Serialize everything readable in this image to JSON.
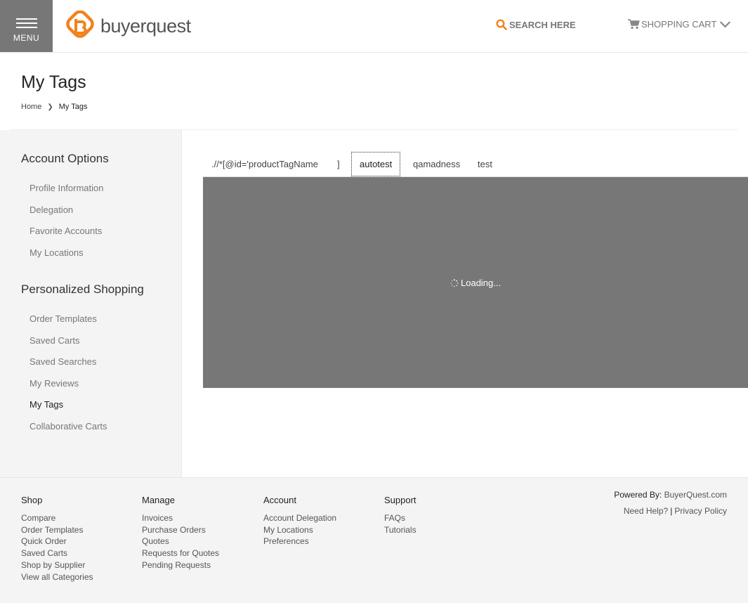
{
  "header": {
    "menu_label": "MENU",
    "logo_text": "buyerquest",
    "search_label": "SEARCH HERE",
    "cart_label": "SHOPPING CART",
    "accent_color": "#f0831e"
  },
  "page": {
    "title": "My Tags",
    "breadcrumb": {
      "home": "Home",
      "current": "My Tags"
    }
  },
  "sidebar": {
    "account_title": "Account Options",
    "account_items": [
      "Profile Information",
      "Delegation",
      "Favorite Accounts",
      "My Locations"
    ],
    "shopping_title": "Personalized Shopping",
    "shopping_items": [
      "Order Templates",
      "Saved Carts",
      "Saved Searches",
      "My Reviews",
      "My Tags",
      "Collaborative Carts"
    ],
    "active_item": "My Tags"
  },
  "tabs": [
    {
      "label": ".//*[@id='productTagName"
    },
    {
      "label": "]"
    },
    {
      "label": "autotest",
      "active": true
    },
    {
      "label": "qamadness"
    },
    {
      "label": "test"
    }
  ],
  "loading": {
    "text": "Loading..."
  },
  "footer": {
    "shop": {
      "title": "Shop",
      "links": [
        "Compare",
        "Order Templates",
        "Quick Order",
        "Saved Carts",
        "Shop by Supplier",
        "View all Categories"
      ]
    },
    "manage": {
      "title": "Manage",
      "links": [
        "Invoices",
        "Purchase Orders",
        "Quotes",
        "Requests for Quotes",
        "Pending Requests"
      ]
    },
    "account": {
      "title": "Account",
      "links": [
        "Account Delegation",
        "My Locations",
        "Preferences"
      ]
    },
    "support": {
      "title": "Support",
      "links": [
        "FAQs",
        "Tutorials"
      ]
    },
    "powered_by_label": "Powered By:",
    "powered_by_brand": "BuyerQuest.com",
    "need_help": "Need Help?",
    "privacy": "Privacy Policy"
  }
}
